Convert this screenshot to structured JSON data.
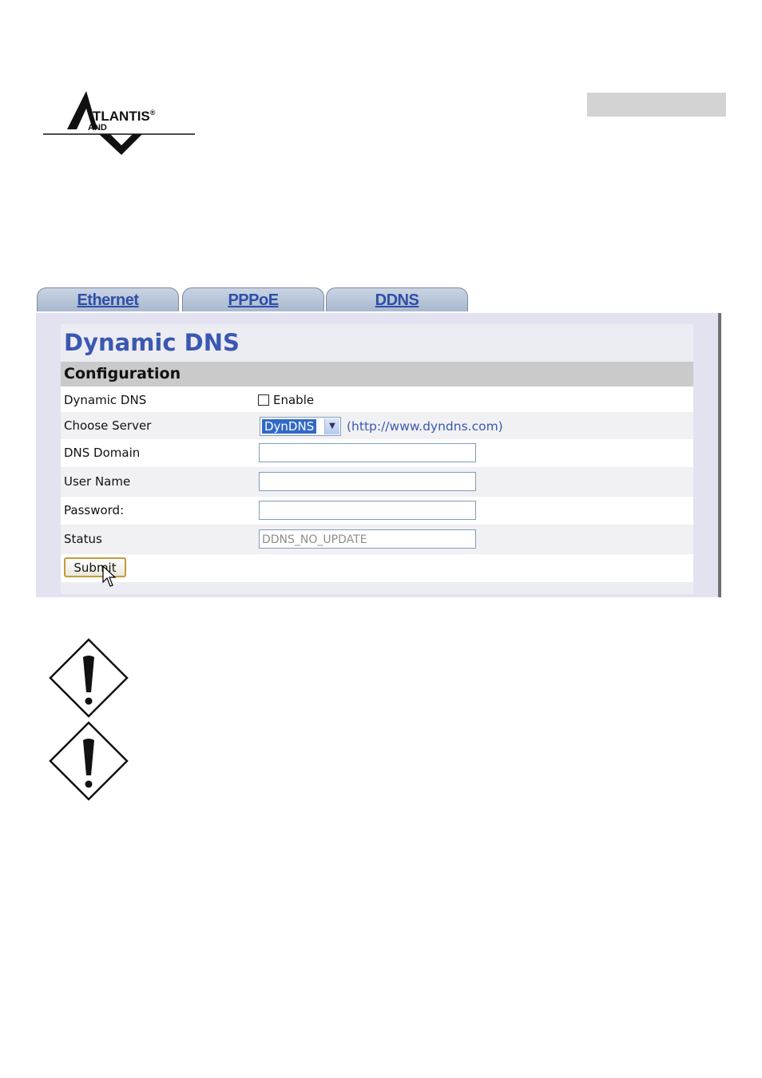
{
  "logo": {
    "word1": "TLANTIS",
    "word2": "AND",
    "registered": "®"
  },
  "tabs": [
    {
      "label": "Ethernet"
    },
    {
      "label": "PPPoE"
    },
    {
      "label": "DDNS"
    }
  ],
  "page": {
    "title": "Dynamic DNS",
    "section": "Configuration"
  },
  "form": {
    "dynamic_dns": {
      "label": "Dynamic DNS",
      "checkbox_label": "Enable",
      "checked": false
    },
    "server": {
      "label": "Choose Server",
      "selected": "DynDNS",
      "link": "(http://www.dyndns.com)"
    },
    "domain": {
      "label": "DNS Domain",
      "value": ""
    },
    "username": {
      "label": "User Name",
      "value": ""
    },
    "password": {
      "label": "Password:",
      "value": ""
    },
    "status": {
      "label": "Status",
      "value": "DDNS_NO_UPDATE"
    },
    "submit_label": "Submit"
  },
  "colors": {
    "accent": "#3b58b0",
    "panel_bg": "#e2e2f0",
    "config_bar": "#cacaca",
    "selected_option": "#3169c6",
    "submit_border": "#c89a3c"
  },
  "icons": [
    "atlantis-logo",
    "chevron-down-icon",
    "mouse-cursor-icon",
    "warning-icon"
  ]
}
